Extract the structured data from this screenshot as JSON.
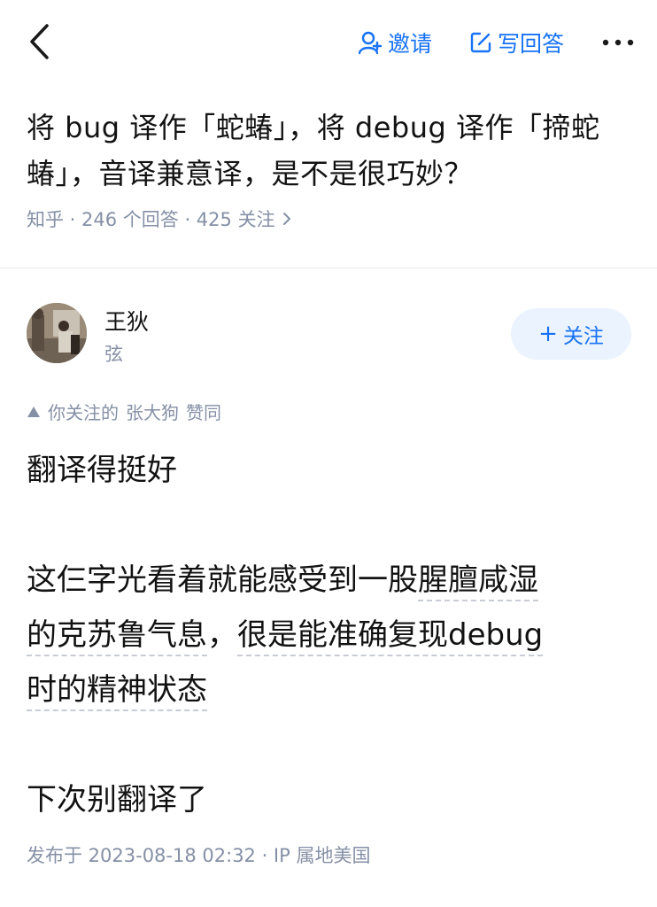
{
  "nav": {
    "back_icon": "chevron-left-icon",
    "invite_label": "邀请",
    "write_label": "写回答",
    "more_icon": "more-dots-icon",
    "accent": "#1772f6"
  },
  "question": {
    "title": "将 bug 译作「蛇蝽」，将 debug 译作「揥蛇蝽」，音译兼意译，是不是很巧妙？",
    "meta": "知乎 · 246 个回答 · 425 关注"
  },
  "author": {
    "name": "王狄",
    "bio": "弦",
    "follow_label": "关注"
  },
  "endorse": {
    "prefix": "你关注的",
    "name": "张大狗",
    "action": "赞同"
  },
  "answer": {
    "p1": "翻译得挺好",
    "p2_line1": "这仨字光看着就能感受到一股",
    "p2_link1": "腥膻咸湿",
    "p2_link2_line": "的克苏鲁气息",
    "p2_comma": "，",
    "p2_link3": "很是能准确复现debug",
    "p2_link3_end": "时的精神状态",
    "p3": "下次别翻译了"
  },
  "publish": "发布于 2023-08-18 02:32 · IP 属地美国"
}
